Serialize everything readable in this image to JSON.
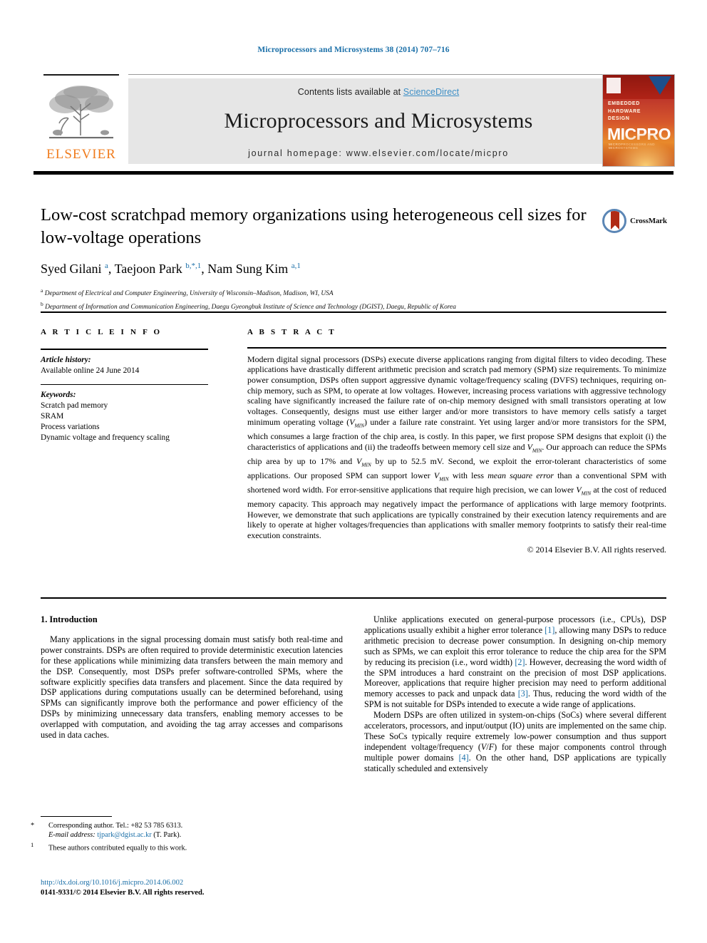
{
  "running_head": "Microprocessors and Microsystems 38 (2014) 707–716",
  "masthead": {
    "contents_prefix": "Contents lists available at ",
    "sciencedirect": "ScienceDirect",
    "journal_title": "Microprocessors and Microsystems",
    "homepage": "journal homepage: www.elsevier.com/locate/micpro",
    "publisher_wordmark": "ELSEVIER",
    "cover_kicker": "EMBEDDED\nHARDWARE\nDESIGN",
    "cover_title": "MICPRO",
    "cover_sub": "MICROPROCESSORS AND MICROSYSTEMS"
  },
  "article": {
    "title": "Low-cost scratchpad memory organizations using heterogeneous cell sizes for low-voltage operations",
    "authors_html": "Syed Gilani <sup>a</sup>, Taejoon Park <sup>b,*,1</sup>, Nam Sung Kim <sup>a,1</sup>",
    "affiliation_a": "Department of Electrical and Computer Engineering, University of Wisconsin–Madison, Madison, WI, USA",
    "affiliation_b": "Department of Information and Communication Engineering, Daegu Gyeongbuk Institute of Science and Technology (DGIST), Daegu, Republic of Korea",
    "crossmark_label": "CrossMark"
  },
  "sections": {
    "article_info_heading": "A R T I C L E  I N F O",
    "abstract_heading": "A B S T R A C T"
  },
  "article_info": {
    "history_label": "Article history:",
    "history_value": "Available online 24 June 2014",
    "keywords_label": "Keywords:",
    "keywords": [
      "Scratch pad memory",
      "SRAM",
      "Process variations",
      "Dynamic voltage and frequency scaling"
    ]
  },
  "abstract": {
    "text": "Modern digital signal processors (DSPs) execute diverse applications ranging from digital filters to video decoding. These applications have drastically different arithmetic precision and scratch pad memory (SPM) size requirements. To minimize power consumption, DSPs often support aggressive dynamic voltage/frequency scaling (DVFS) techniques, requiring on-chip memory, such as SPM, to operate at low voltages. However, increasing process variations with aggressive technology scaling have significantly increased the failure rate of on-chip memory designed with small transistors operating at low voltages. Consequently, designs must use either larger and/or more transistors to have memory cells satisfy a target minimum operating voltage (VMIN) under a failure rate constraint. Yet using larger and/or more transistors for the SPM, which consumes a large fraction of the chip area, is costly. In this paper, we first propose SPM designs that exploit (i) the characteristics of applications and (ii) the tradeoffs between memory cell size and VMIN. Our approach can reduce the SPMs chip area by up to 17% and VMIN by up to 52.5 mV. Second, we exploit the error-tolerant characteristics of some applications. Our proposed SPM can support lower VMIN with less mean square error than a conventional SPM with shortened word width. For error-sensitive applications that require high precision, we can lower VMIN at the cost of reduced memory capacity. This approach may negatively impact the performance of applications with large memory footprints. However, we demonstrate that such applications are typically constrained by their execution latency requirements and are likely to operate at higher voltages/frequencies than applications with smaller memory footprints to satisfy their real-time execution constraints.",
    "copyright": "© 2014 Elsevier B.V. All rights reserved."
  },
  "body": {
    "section_number_title": "1. Introduction",
    "left_paragraph_1": "Many applications in the signal processing domain must satisfy both real-time and power constraints. DSPs are often required to provide deterministic execution latencies for these applications while minimizing data transfers between the main memory and the DSP. Consequently, most DSPs prefer software-controlled SPMs, where the software explicitly specifies data transfers and placement. Since the data required by DSP applications during computations usually can be determined beforehand, using SPMs can significantly improve both the performance and power efficiency of the DSPs by minimizing unnecessary data transfers, enabling memory accesses to be overlapped with computation, and avoiding the tag array accesses and comparisons used in data caches.",
    "right_paragraph_1": "Unlike applications executed on general-purpose processors (i.e., CPUs), DSP applications usually exhibit a higher error tolerance [1], allowing many DSPs to reduce arithmetic precision to decrease power consumption. In designing on-chip memory such as SPMs, we can exploit this error tolerance to reduce the chip area for the SPM by reducing its precision (i.e., word width) [2]. However, decreasing the word width of the SPM introduces a hard constraint on the precision of most DSP applications. Moreover, applications that require higher precision may need to perform additional memory accesses to pack and unpack data [3]. Thus, reducing the word width of the SPM is not suitable for DSPs intended to execute a wide range of applications.",
    "right_paragraph_2": "Modern DSPs are often utilized in system-on-chips (SoCs) where several different accelerators, processors, and input/output (IO) units are implemented on the same chip. These SoCs typically require extremely low-power consumption and thus support independent voltage/frequency (V/F) for these major components control through multiple power domains [4]. On the other hand, DSP applications are typically statically scheduled and extensively"
  },
  "footnotes": {
    "corresponding": "Corresponding author. Tel.: +82 53 785 6313.",
    "email_label": "E-mail address:",
    "email": "tjpark@dgist.ac.kr",
    "email_suffix": "(T. Park).",
    "equal_contrib": "These authors contributed equally to this work.",
    "doi": "http://dx.doi.org/10.1016/j.micpro.2014.06.002",
    "issn_line": "0141-9331/© 2014 Elsevier B.V. All rights reserved."
  },
  "colors": {
    "link": "#1a6fa8",
    "sciencedirect": "#3d8fc6",
    "elsevier_orange": "#f07c1e",
    "banner_bg": "#e6e6e6"
  }
}
